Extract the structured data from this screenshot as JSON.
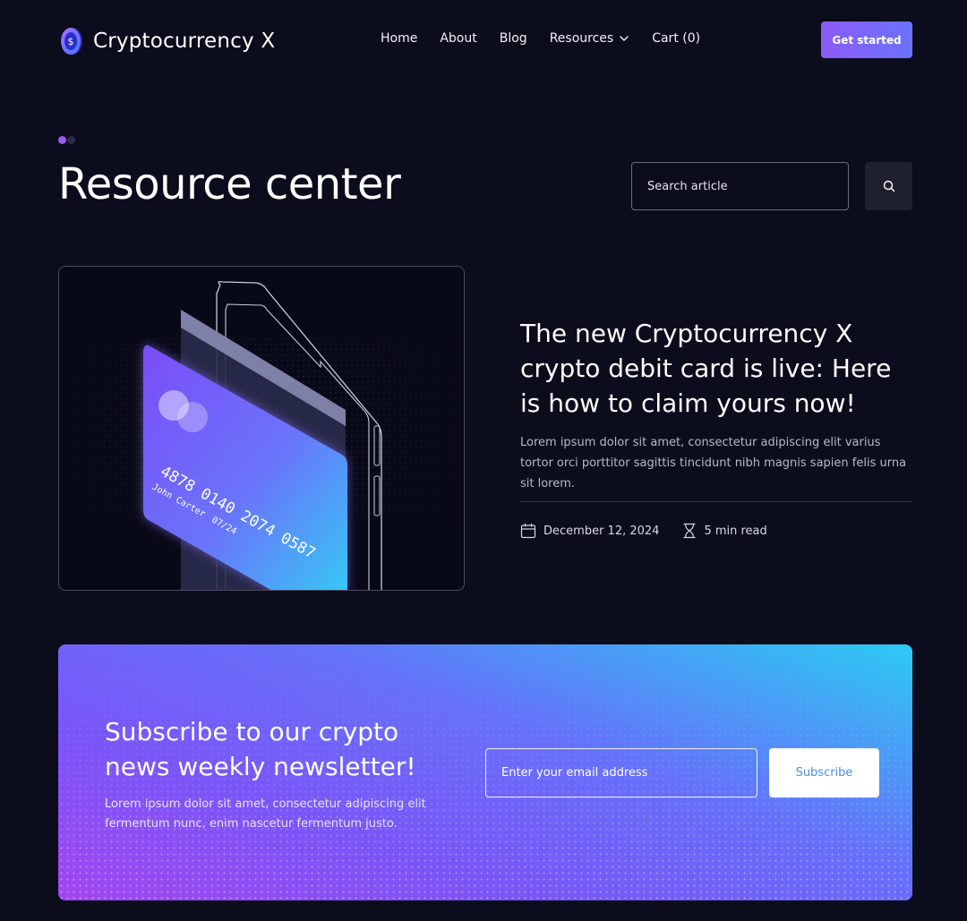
{
  "brand": {
    "name": "Cryptocurrency X",
    "logo_icon": "coin-dollar-icon"
  },
  "nav": {
    "items": [
      {
        "label": "Home"
      },
      {
        "label": "About"
      },
      {
        "label": "Blog"
      },
      {
        "label": "Resources",
        "has_dropdown": true
      },
      {
        "label": "Cart (0)"
      }
    ],
    "cta_label": "Get started"
  },
  "hero": {
    "title": "Resource center",
    "slider_dots": 2,
    "active_dot": 1,
    "search": {
      "placeholder": "Search article",
      "button_icon": "search-icon"
    }
  },
  "featured": {
    "title": "The new Cryptocurrency X crypto debit card is live: Here is how to claim yours now!",
    "description": "Lorem ipsum dolor sit amet, consectetur adipiscing elit varius tortor orci porttitor sagittis tincidunt nibh magnis sapien felis urna sit lorem.",
    "date": "December 12, 2024",
    "read_time": "5 min read",
    "card": {
      "number": "4878 0140 2074 0587",
      "holder": "John Carter",
      "expiry": "07/24"
    }
  },
  "newsletter": {
    "title": "Subscribe to our crypto news weekly newsletter!",
    "description": "Lorem ipsum dolor sit amet, consectetur adipiscing elit fermentum nunc, enim nascetur fermentum justo.",
    "email_placeholder": "Enter your email address",
    "button_label": "Subscribe"
  },
  "colors": {
    "background": "#0b0c1c",
    "accent_purple": "#8b5cf6",
    "accent_cyan": "#2ccaf3",
    "subscribe_text": "#4a8fe6"
  }
}
